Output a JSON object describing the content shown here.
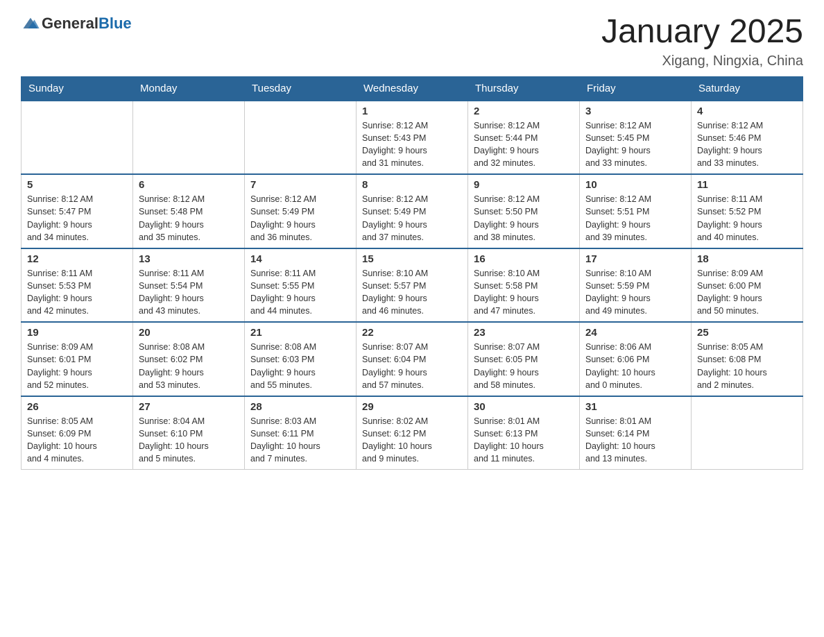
{
  "header": {
    "logo_text_general": "General",
    "logo_text_blue": "Blue",
    "month_title": "January 2025",
    "location": "Xigang, Ningxia, China"
  },
  "days_of_week": [
    "Sunday",
    "Monday",
    "Tuesday",
    "Wednesday",
    "Thursday",
    "Friday",
    "Saturday"
  ],
  "weeks": [
    [
      {
        "day": "",
        "info": ""
      },
      {
        "day": "",
        "info": ""
      },
      {
        "day": "",
        "info": ""
      },
      {
        "day": "1",
        "info": "Sunrise: 8:12 AM\nSunset: 5:43 PM\nDaylight: 9 hours\nand 31 minutes."
      },
      {
        "day": "2",
        "info": "Sunrise: 8:12 AM\nSunset: 5:44 PM\nDaylight: 9 hours\nand 32 minutes."
      },
      {
        "day": "3",
        "info": "Sunrise: 8:12 AM\nSunset: 5:45 PM\nDaylight: 9 hours\nand 33 minutes."
      },
      {
        "day": "4",
        "info": "Sunrise: 8:12 AM\nSunset: 5:46 PM\nDaylight: 9 hours\nand 33 minutes."
      }
    ],
    [
      {
        "day": "5",
        "info": "Sunrise: 8:12 AM\nSunset: 5:47 PM\nDaylight: 9 hours\nand 34 minutes."
      },
      {
        "day": "6",
        "info": "Sunrise: 8:12 AM\nSunset: 5:48 PM\nDaylight: 9 hours\nand 35 minutes."
      },
      {
        "day": "7",
        "info": "Sunrise: 8:12 AM\nSunset: 5:49 PM\nDaylight: 9 hours\nand 36 minutes."
      },
      {
        "day": "8",
        "info": "Sunrise: 8:12 AM\nSunset: 5:49 PM\nDaylight: 9 hours\nand 37 minutes."
      },
      {
        "day": "9",
        "info": "Sunrise: 8:12 AM\nSunset: 5:50 PM\nDaylight: 9 hours\nand 38 minutes."
      },
      {
        "day": "10",
        "info": "Sunrise: 8:12 AM\nSunset: 5:51 PM\nDaylight: 9 hours\nand 39 minutes."
      },
      {
        "day": "11",
        "info": "Sunrise: 8:11 AM\nSunset: 5:52 PM\nDaylight: 9 hours\nand 40 minutes."
      }
    ],
    [
      {
        "day": "12",
        "info": "Sunrise: 8:11 AM\nSunset: 5:53 PM\nDaylight: 9 hours\nand 42 minutes."
      },
      {
        "day": "13",
        "info": "Sunrise: 8:11 AM\nSunset: 5:54 PM\nDaylight: 9 hours\nand 43 minutes."
      },
      {
        "day": "14",
        "info": "Sunrise: 8:11 AM\nSunset: 5:55 PM\nDaylight: 9 hours\nand 44 minutes."
      },
      {
        "day": "15",
        "info": "Sunrise: 8:10 AM\nSunset: 5:57 PM\nDaylight: 9 hours\nand 46 minutes."
      },
      {
        "day": "16",
        "info": "Sunrise: 8:10 AM\nSunset: 5:58 PM\nDaylight: 9 hours\nand 47 minutes."
      },
      {
        "day": "17",
        "info": "Sunrise: 8:10 AM\nSunset: 5:59 PM\nDaylight: 9 hours\nand 49 minutes."
      },
      {
        "day": "18",
        "info": "Sunrise: 8:09 AM\nSunset: 6:00 PM\nDaylight: 9 hours\nand 50 minutes."
      }
    ],
    [
      {
        "day": "19",
        "info": "Sunrise: 8:09 AM\nSunset: 6:01 PM\nDaylight: 9 hours\nand 52 minutes."
      },
      {
        "day": "20",
        "info": "Sunrise: 8:08 AM\nSunset: 6:02 PM\nDaylight: 9 hours\nand 53 minutes."
      },
      {
        "day": "21",
        "info": "Sunrise: 8:08 AM\nSunset: 6:03 PM\nDaylight: 9 hours\nand 55 minutes."
      },
      {
        "day": "22",
        "info": "Sunrise: 8:07 AM\nSunset: 6:04 PM\nDaylight: 9 hours\nand 57 minutes."
      },
      {
        "day": "23",
        "info": "Sunrise: 8:07 AM\nSunset: 6:05 PM\nDaylight: 9 hours\nand 58 minutes."
      },
      {
        "day": "24",
        "info": "Sunrise: 8:06 AM\nSunset: 6:06 PM\nDaylight: 10 hours\nand 0 minutes."
      },
      {
        "day": "25",
        "info": "Sunrise: 8:05 AM\nSunset: 6:08 PM\nDaylight: 10 hours\nand 2 minutes."
      }
    ],
    [
      {
        "day": "26",
        "info": "Sunrise: 8:05 AM\nSunset: 6:09 PM\nDaylight: 10 hours\nand 4 minutes."
      },
      {
        "day": "27",
        "info": "Sunrise: 8:04 AM\nSunset: 6:10 PM\nDaylight: 10 hours\nand 5 minutes."
      },
      {
        "day": "28",
        "info": "Sunrise: 8:03 AM\nSunset: 6:11 PM\nDaylight: 10 hours\nand 7 minutes."
      },
      {
        "day": "29",
        "info": "Sunrise: 8:02 AM\nSunset: 6:12 PM\nDaylight: 10 hours\nand 9 minutes."
      },
      {
        "day": "30",
        "info": "Sunrise: 8:01 AM\nSunset: 6:13 PM\nDaylight: 10 hours\nand 11 minutes."
      },
      {
        "day": "31",
        "info": "Sunrise: 8:01 AM\nSunset: 6:14 PM\nDaylight: 10 hours\nand 13 minutes."
      },
      {
        "day": "",
        "info": ""
      }
    ]
  ]
}
